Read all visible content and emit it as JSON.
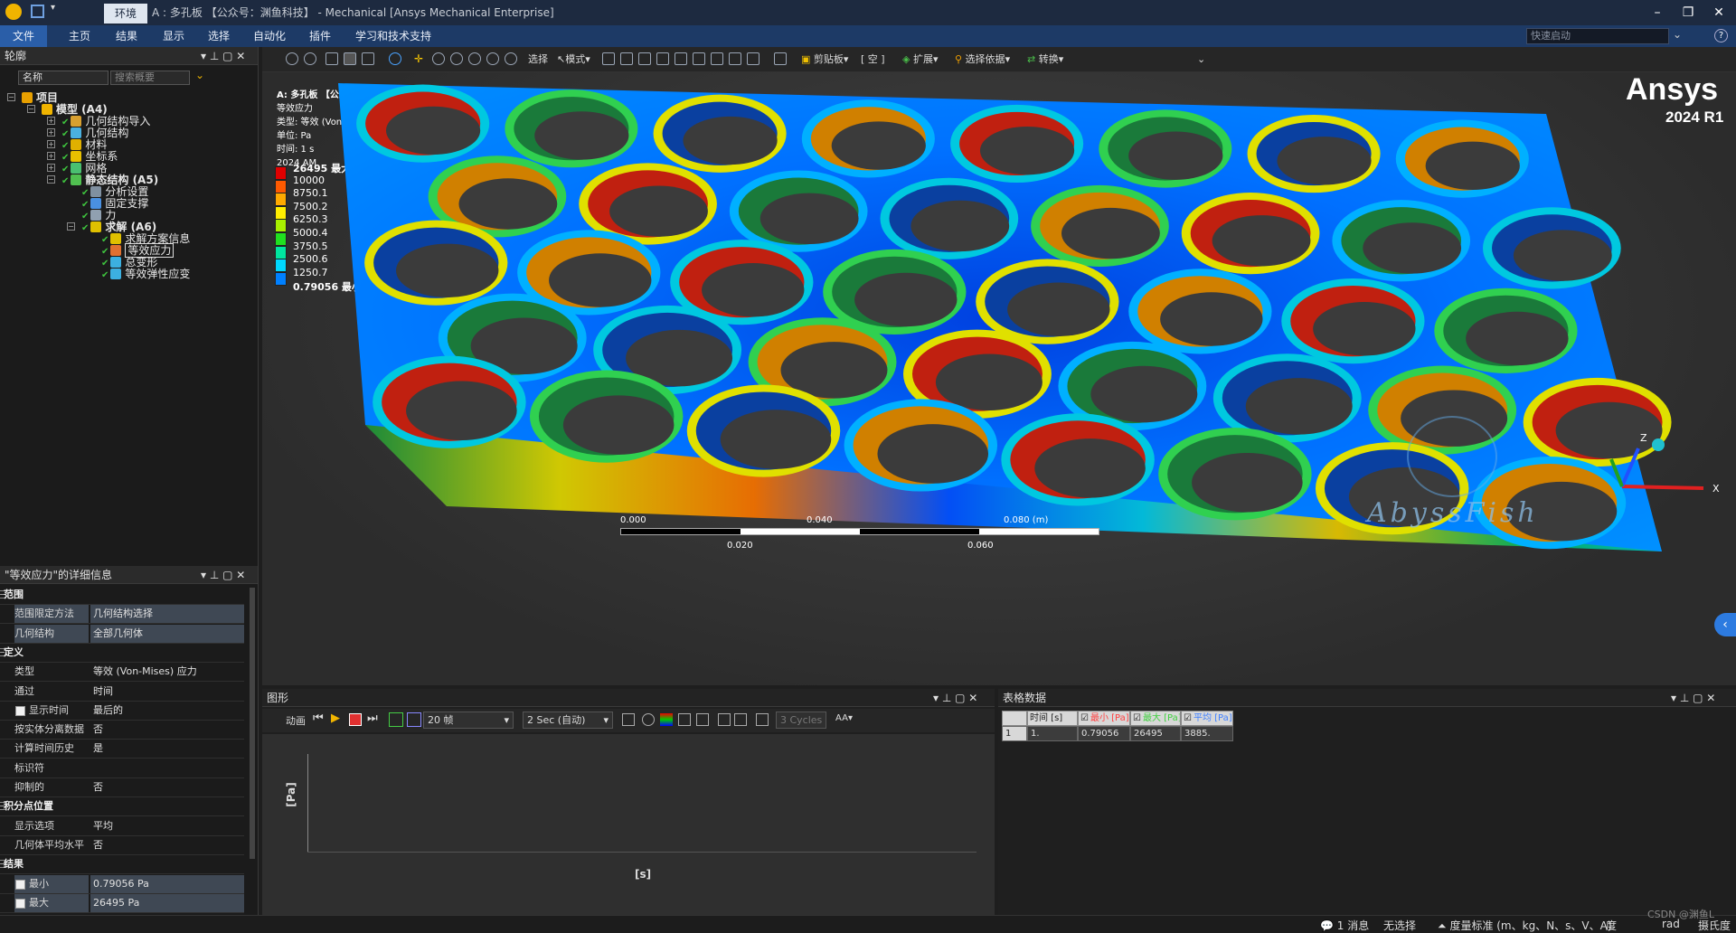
{
  "titlebar": {
    "context_tab": "环境",
    "title": "A : 多孔板 【公众号：渊鱼科技】 - Mechanical [Ansys Mechanical Enterprise]",
    "minimize": "–",
    "restore": "❐",
    "close": "✕"
  },
  "menu": {
    "items": [
      "文件",
      "主页",
      "结果",
      "显示",
      "选择",
      "自动化",
      "插件",
      "学习和技术支持"
    ],
    "quick_launch_placeholder": "快速启动"
  },
  "outline": {
    "title": "轮廓",
    "name_dropdown": "名称",
    "search_placeholder": "搜索概要",
    "tree": [
      {
        "label": "项目",
        "level": 0,
        "bold": true
      },
      {
        "label": "模型 (A4)",
        "level": 1,
        "bold": true
      },
      {
        "label": "几何结构导入",
        "level": 2
      },
      {
        "label": "几何结构",
        "level": 2
      },
      {
        "label": "材料",
        "level": 2
      },
      {
        "label": "坐标系",
        "level": 2
      },
      {
        "label": "网格",
        "level": 2
      },
      {
        "label": "静态结构 (A5)",
        "level": 2,
        "bold": true
      },
      {
        "label": "分析设置",
        "level": 3
      },
      {
        "label": "固定支撑",
        "level": 3
      },
      {
        "label": "力",
        "level": 3
      },
      {
        "label": "求解 (A6)",
        "level": 3,
        "bold": true
      },
      {
        "label": "求解方案信息",
        "level": 4
      },
      {
        "label": "等效应力",
        "level": 4,
        "selected": true
      },
      {
        "label": "总变形",
        "level": 4
      },
      {
        "label": "等效弹性应变",
        "level": 4
      }
    ]
  },
  "details": {
    "title": "\"等效应力\"的详细信息",
    "rows": [
      {
        "k": "范围",
        "group": true
      },
      {
        "k": "范围限定方法",
        "v": "几何结构选择",
        "hl": true
      },
      {
        "k": "几何结构",
        "v": "全部几何体",
        "hl": true
      },
      {
        "k": "定义",
        "group": true
      },
      {
        "k": "类型",
        "v": "等效 (Von-Mises) 应力"
      },
      {
        "k": "通过",
        "v": "时间"
      },
      {
        "k": "显示时间",
        "v": "最后的",
        "cb": true
      },
      {
        "k": "按实体分离数据",
        "v": "否"
      },
      {
        "k": "计算时间历史",
        "v": "是"
      },
      {
        "k": "标识符",
        "v": ""
      },
      {
        "k": "抑制的",
        "v": "否"
      },
      {
        "k": "积分点位置",
        "group": true
      },
      {
        "k": "显示选项",
        "v": "平均"
      },
      {
        "k": "几何体平均水平",
        "v": "否"
      },
      {
        "k": "结果",
        "group": true
      },
      {
        "k": "最小",
        "v": "0.79056 Pa",
        "cb": true,
        "hl": true
      },
      {
        "k": "最大",
        "v": "26495 Pa",
        "cb": true,
        "hl": true
      }
    ]
  },
  "toolbar": {
    "select": "选择",
    "mode": "模式",
    "clipboard": "剪贴板",
    "empty": "[ 空 ]",
    "extend": "扩展",
    "select_by": "选择依据",
    "convert": "转换"
  },
  "viewport": {
    "header": [
      "A: 多孔板 【公众号：渊鱼科技】",
      "等效应力",
      "类型: 等效 (Von-Mises) 应力",
      "单位: Pa",
      "时间: 1 s",
      "2024 AM"
    ],
    "brand": "Ansys",
    "version": "2024 R1",
    "watermark": "AbyssFish",
    "legend": {
      "labels": [
        "26495 最大",
        "10000",
        "8750.1",
        "7500.2",
        "6250.3",
        "5000.4",
        "3750.5",
        "2500.6",
        "1250.7",
        "0.79056 最小"
      ],
      "colors": [
        "#e00000",
        "#ff5a00",
        "#ffaa00",
        "#ffee00",
        "#a8f000",
        "#20e020",
        "#00e6a0",
        "#00d8ff",
        "#0080ff",
        "#0010e0"
      ]
    },
    "scale": {
      "top": [
        "0.000",
        "0.040",
        "0.080 (m)"
      ],
      "bottom": [
        "0.020",
        "0.060"
      ]
    },
    "axes": {
      "x": "X",
      "z": "Z"
    }
  },
  "graph": {
    "title": "图形",
    "animation": "动画",
    "frames": "20 帧",
    "duration": "2 Sec (自动)",
    "cycles": "3 Cycles",
    "y_label": "[Pa]",
    "x_label": "[s]"
  },
  "table": {
    "title": "表格数据",
    "headers": [
      "时间 [s]",
      "最小 [Pa]",
      "最大 [Pa]",
      "平均 [Pa]"
    ],
    "header_colors": [
      "#e0e0e0",
      "#ff4040",
      "#40d040",
      "#4080ff"
    ],
    "rows": [
      [
        "1",
        "1.",
        "0.79056",
        "26495",
        "3885."
      ]
    ]
  },
  "statusbar": {
    "messages": "1 消息",
    "no_selection": "无选择",
    "units": "度量标准 (m、kg、N、s、V、A)",
    "deg": "度",
    "rad": "rad",
    "watermark": "CSDN @渊鱼L",
    "extra": "摄氏度"
  }
}
